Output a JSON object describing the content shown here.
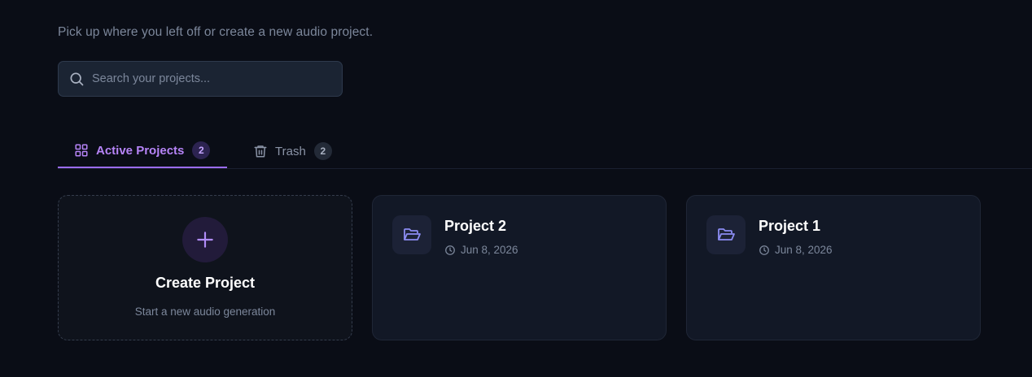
{
  "header": {
    "subtitle": "Pick up where you left off or create a new audio project."
  },
  "search": {
    "placeholder": "Search your projects...",
    "value": ""
  },
  "tabs": [
    {
      "label": "Active Projects",
      "count": "2",
      "icon": "grid-icon",
      "active": true
    },
    {
      "label": "Trash",
      "count": "2",
      "icon": "trash-icon",
      "active": false
    }
  ],
  "create_card": {
    "title": "Create Project",
    "subtitle": "Start a new audio generation",
    "icon": "plus-icon"
  },
  "projects": [
    {
      "title": "Project 2",
      "date": "Jun 8, 2026",
      "icon": "folder-open-icon"
    },
    {
      "title": "Project 1",
      "date": "Jun 8, 2026",
      "icon": "folder-open-icon"
    }
  ],
  "colors": {
    "background": "#0a0d16",
    "accent": "#9b6cf0",
    "card": "#121826",
    "muted_text": "#7c879b"
  }
}
